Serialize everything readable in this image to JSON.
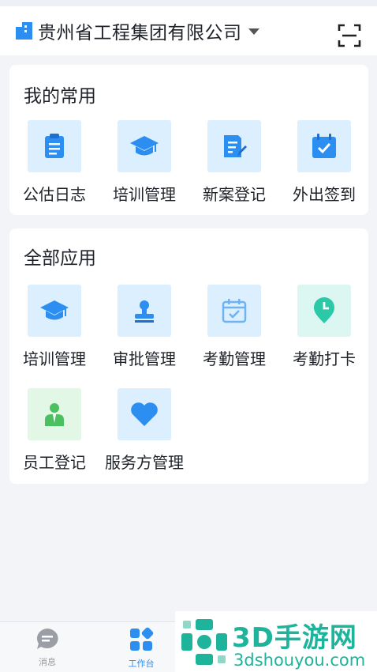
{
  "header": {
    "company_name": "贵州省工程集团有限公司"
  },
  "my_common": {
    "title": "我的常用",
    "apps": [
      {
        "label": "公估日志",
        "icon": "clipboard-icon"
      },
      {
        "label": "培训管理",
        "icon": "graduation-cap-icon"
      },
      {
        "label": "新案登记",
        "icon": "document-edit-icon"
      },
      {
        "label": "外出签到",
        "icon": "calendar-check-icon"
      }
    ]
  },
  "all_apps": {
    "title": "全部应用",
    "apps": [
      {
        "label": "培训管理",
        "icon": "graduation-cap-icon"
      },
      {
        "label": "审批管理",
        "icon": "stamp-icon"
      },
      {
        "label": "考勤管理",
        "icon": "calendar-check-outline-icon"
      },
      {
        "label": "考勤打卡",
        "icon": "clock-pin-icon"
      },
      {
        "label": "员工登记",
        "icon": "employee-icon"
      },
      {
        "label": "服务方管理",
        "icon": "heart-icon"
      }
    ]
  },
  "tabbar": {
    "tabs": [
      {
        "label": "消息",
        "icon": "chat-bubble-icon",
        "active": false
      },
      {
        "label": "工作台",
        "icon": "apps-grid-icon",
        "active": true
      }
    ]
  },
  "watermark": {
    "title": "3D手游网",
    "url": "3dshouyou.com"
  },
  "colors": {
    "accent": "#2b8ef0",
    "tile_blue": "#dcefff",
    "teal": "#2cc9a8",
    "green": "#4cc061"
  }
}
